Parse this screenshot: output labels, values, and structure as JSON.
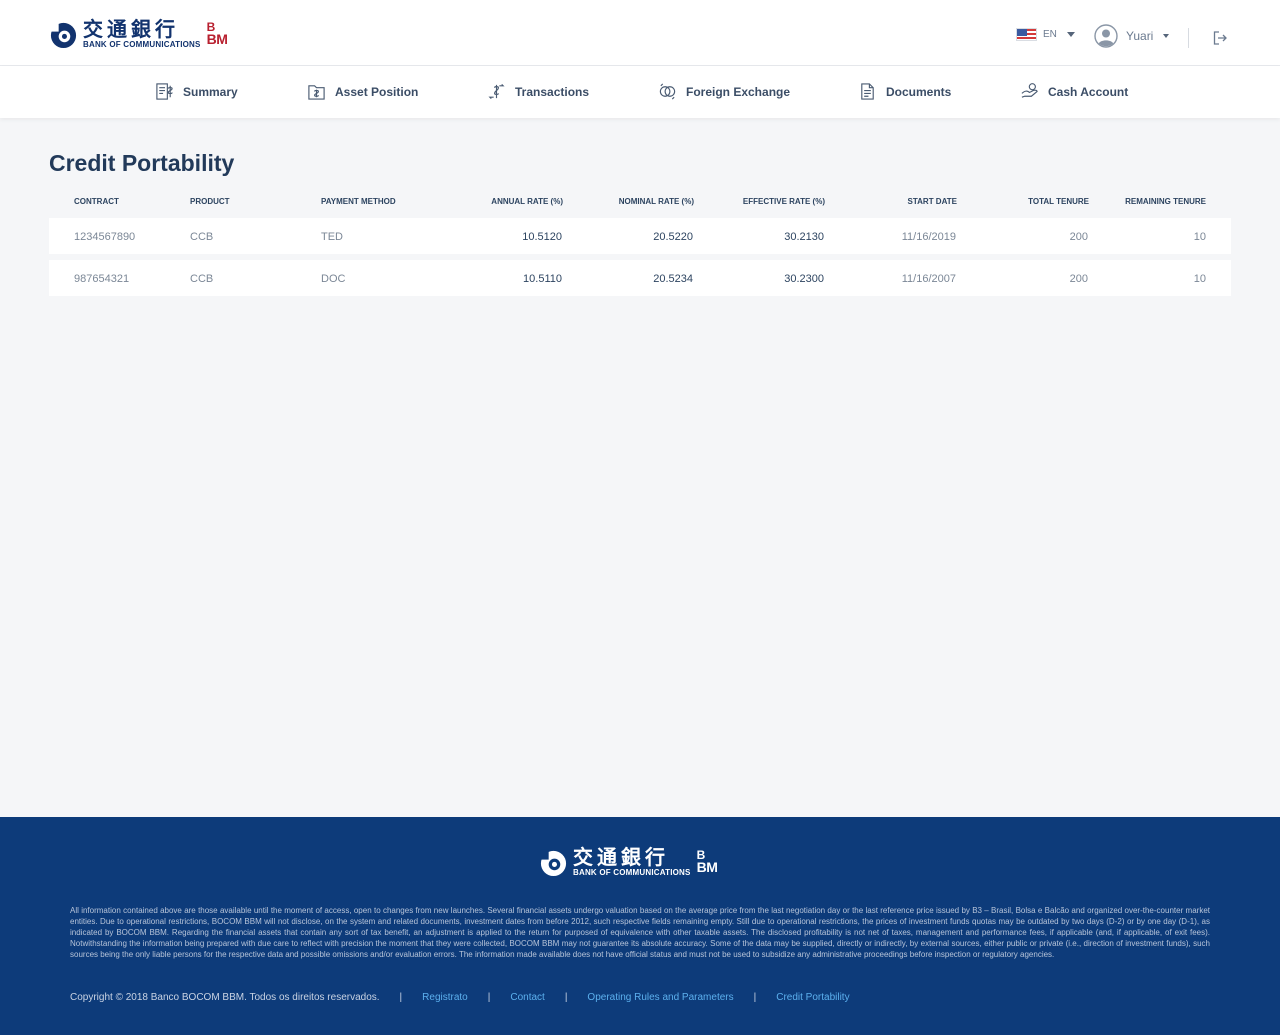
{
  "header": {
    "logo_cn": "交通銀行",
    "logo_en": "BANK OF COMMUNICATIONS",
    "logo_b": "B",
    "logo_bm": "BM",
    "language": "EN",
    "user_name": "Yuari"
  },
  "nav": {
    "items": [
      {
        "label": "Summary",
        "icon": "summary-icon"
      },
      {
        "label": "Asset Position",
        "icon": "asset-position-icon"
      },
      {
        "label": "Transactions",
        "icon": "transactions-icon"
      },
      {
        "label": "Foreign Exchange",
        "icon": "foreign-exchange-icon"
      },
      {
        "label": "Documents",
        "icon": "documents-icon"
      },
      {
        "label": "Cash Account",
        "icon": "cash-account-icon"
      }
    ]
  },
  "page": {
    "title": "Credit Portability"
  },
  "table": {
    "columns": [
      "CONTRACT",
      "PRODUCT",
      "PAYMENT METHOD",
      "ANNUAL RATE (%)",
      "NOMINAL RATE (%)",
      "EFFECTIVE RATE (%)",
      "START DATE",
      "TOTAL TENURE",
      "REMAINING TENURE"
    ],
    "rows": [
      [
        "1234567890",
        "CCB",
        "TED",
        "10.5120",
        "20.5220",
        "30.2130",
        "11/16/2019",
        "200",
        "10"
      ],
      [
        "987654321",
        "CCB",
        "DOC",
        "10.5110",
        "20.5234",
        "30.2300",
        "11/16/2007",
        "200",
        "10"
      ]
    ]
  },
  "footer": {
    "disclaimer": "All information contained above are those available until the moment of access, open to changes from new launches. Several financial assets undergo valuation based on the average price from the last negotiation day or the last reference price issued by B3 – Brasil, Bolsa e Balcão and organized over-the-counter market entities. Due to operational restrictions, BOCOM BBM will not disclose, on the system and related documents, investment dates from before 2012, such respective fields remaining empty. Still due to operational restrictions, the prices of investment funds quotas may be outdated by two days (D-2) or by one day (D-1), as indicated by BOCOM BBM. Regarding the financial assets that contain any sort of tax benefit, an adjustment is applied to the return for purposed of equivalence with other taxable assets. The disclosed profitability is not net of taxes, management and performance fees, if applicable (and, if applicable, of exit fees). Notwithstanding the information being prepared with due care to reflect with precision the moment that they were collected, BOCOM BBM may not guarantee its absolute accuracy. Some of the data may be supplied, directly or indirectly, by external sources, either public or private (i.e., direction of investment funds), such sources being the only liable persons for the respective data and possible omissions and/or evaluation errors. The information made available does not have official status and must not be used to subsidize any administrative proceedings before inspection or regulatory agencies.",
    "copyright": "Copyright © 2018 Banco BOCOM BBM. Todos os direitos reservados.",
    "separator": "|",
    "links": [
      "Registrato",
      "Contact",
      "Operating Rules and Parameters",
      "Credit Portability"
    ]
  },
  "colors": {
    "brand_navy": "#0d3b7a",
    "brand_red": "#b8202f",
    "link_blue": "#5cb0ee",
    "heading": "#223a5a"
  }
}
